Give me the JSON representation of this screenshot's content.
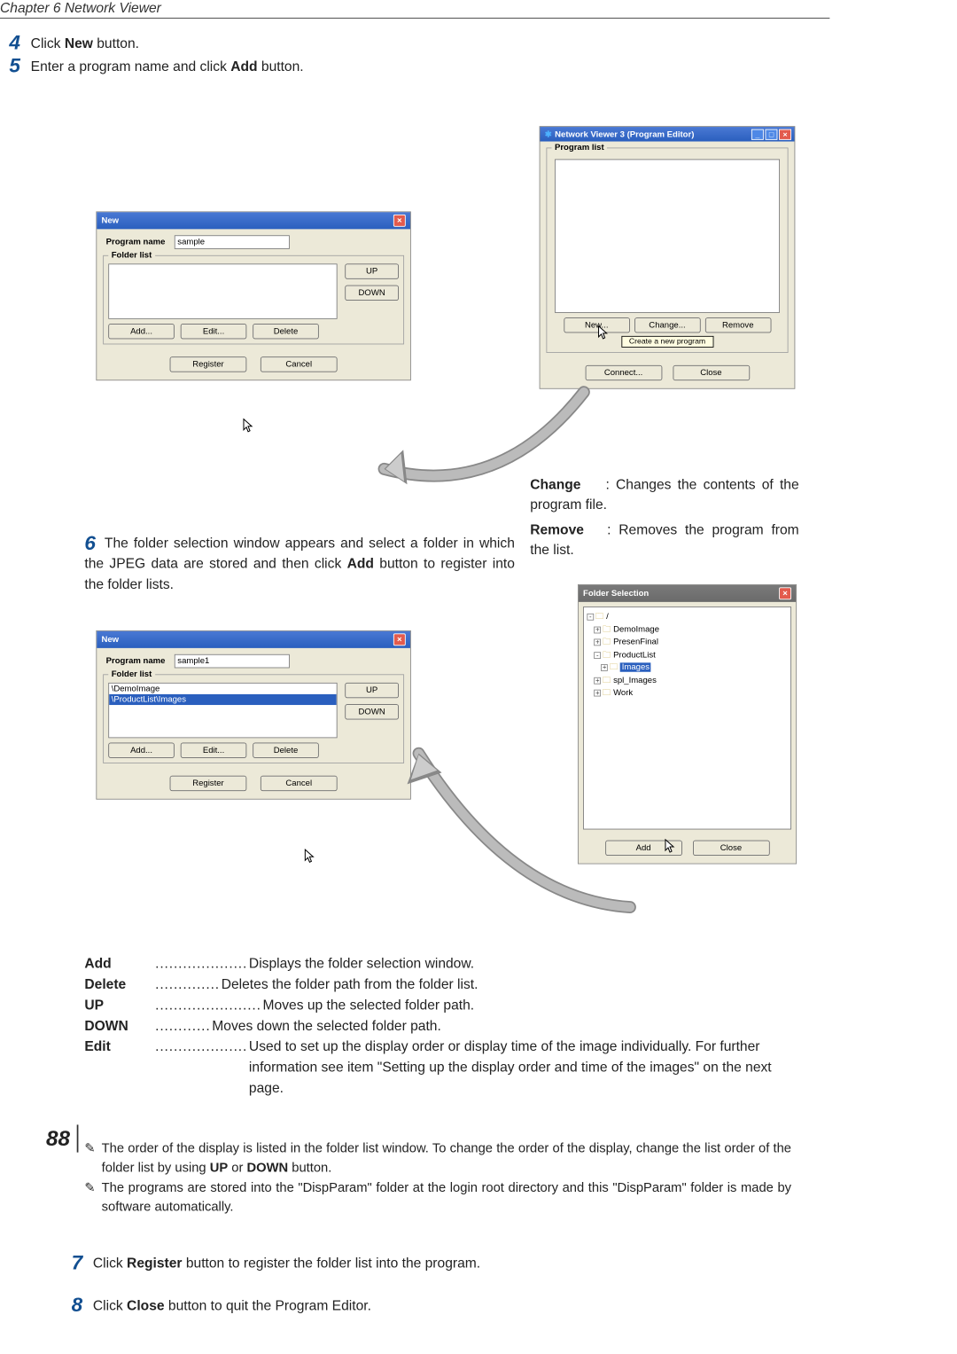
{
  "chapter": "Chapter 6 Network Viewer",
  "steps": {
    "s4": {
      "num": "4",
      "pre": " Click ",
      "bold": "New",
      "post": " button."
    },
    "s5": {
      "num": "5",
      "pre": " Enter a program name and click ",
      "bold": "Add",
      "post": " button."
    },
    "s6": {
      "num": "6",
      "text": "The folder selection window appears and select a folder in which the JPEG data are stored and then click ",
      "bold": "Add",
      "post": " button to register into the folder lists."
    },
    "s7": {
      "num": "7",
      "pre": " Click ",
      "bold": "Register",
      "post": " button to register the folder list into the program."
    },
    "s8": {
      "num": "8",
      "pre": " Click ",
      "bold": "Close",
      "post": " button to quit the Program Editor."
    }
  },
  "new1": {
    "title": "New",
    "program_name_label": "Program name",
    "program_name_value": "sample",
    "folder_list_label": "Folder list",
    "up": "UP",
    "down": "DOWN",
    "add": "Add...",
    "edit": "Edit...",
    "delete": "Delete",
    "register": "Register",
    "cancel": "Cancel"
  },
  "progEditor": {
    "title": "Network Viewer 3 (Program Editor)",
    "program_list_label": "Program list",
    "new": "New...",
    "change": "Change...",
    "remove": "Remove",
    "tip": "Create a new program",
    "connect": "Connect...",
    "close": "Close"
  },
  "desc": {
    "change_term": "Change",
    "change_text": ": Changes the contents of the program file.",
    "remove_term": "Remove",
    "remove_text": ": Removes the program from the list."
  },
  "new2": {
    "title": "New",
    "program_name_label": "Program name",
    "program_name_value": "sample1",
    "folder_list_label": "Folder list",
    "item0": "\\DemoImage",
    "item1": "\\ProductList\\Images",
    "up": "UP",
    "down": "DOWN",
    "add": "Add...",
    "edit": "Edit...",
    "delete": "Delete",
    "register": "Register",
    "cancel": "Cancel"
  },
  "folderSel": {
    "title": "Folder Selection",
    "root": "/",
    "items": [
      "DemoImage",
      "PresenFinal",
      "ProductList",
      "Images",
      "spl_Images",
      "Work"
    ],
    "add": "Add",
    "close": "Close"
  },
  "funcs": {
    "add": {
      "term": "Add",
      "def": "Displays the folder selection window."
    },
    "delete": {
      "term": "Delete",
      "def": "Deletes the folder path from the folder list."
    },
    "up": {
      "term": "UP",
      "def": "Moves up the selected folder path."
    },
    "down": {
      "term": "DOWN",
      "def": "Moves down the selected folder path."
    },
    "edit": {
      "term": "Edit",
      "def": "Used to set up the display order or display time of the image individually. For further information see item \"Setting up the display order and time of the images\" on the next page."
    }
  },
  "notes": {
    "n1a": "The order of the display is listed in the folder list window. To change the order of the display, change the list order of the folder list by using ",
    "n1b": "UP",
    "n1c": " or ",
    "n1d": "DOWN",
    "n1e": " button.",
    "n2": "The programs are stored into the \"DispParam\" folder  at the login root directory and this \"DispParam\" folder is made by software automatically."
  },
  "pageNum": "88"
}
